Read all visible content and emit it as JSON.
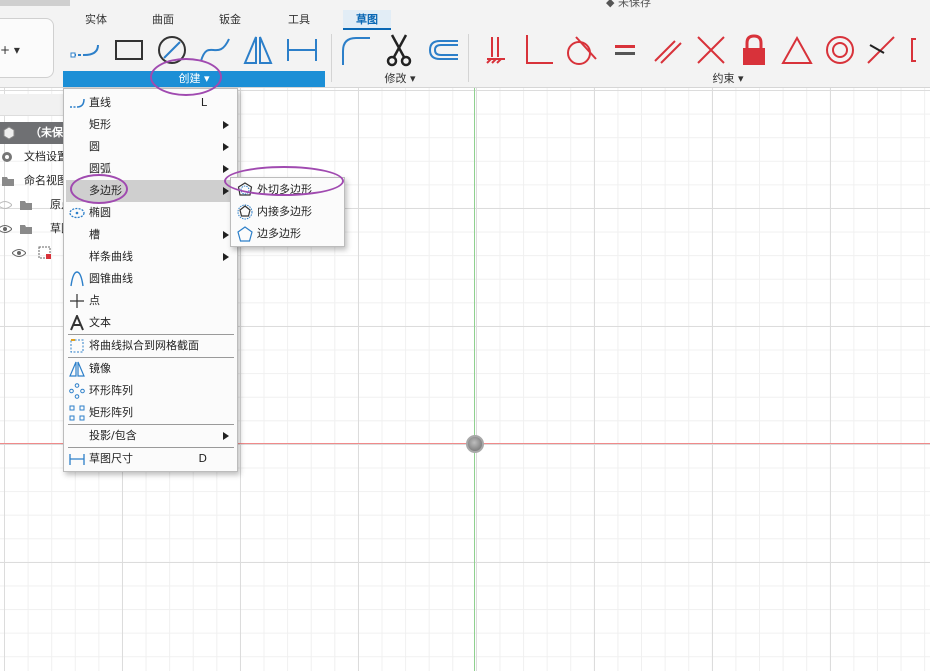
{
  "window": {
    "title": "未保存"
  },
  "workspace": {
    "label": "+ ▾"
  },
  "tabs": [
    {
      "label": "实体"
    },
    {
      "label": "曲面"
    },
    {
      "label": "钣金"
    },
    {
      "label": "工具"
    },
    {
      "label": "草图"
    }
  ],
  "groups": {
    "create": "创建 ▾",
    "modify": "修改 ▾",
    "constraints": "约束 ▾"
  },
  "browser": {
    "root": "（未保存）",
    "items": [
      {
        "label": "文档设置",
        "icon": "gear-icon"
      },
      {
        "label": "命名视图",
        "icon": "folder-icon"
      },
      {
        "label": "原点",
        "icon": "folder-icon"
      },
      {
        "label": "草图",
        "icon": "folder-icon"
      }
    ]
  },
  "create_menu": {
    "items": [
      {
        "label": "直线",
        "shortcut": "L",
        "icon": "line-icon"
      },
      {
        "label": "矩形",
        "icon": "rectangle-icon"
      },
      {
        "label": "圆",
        "icon": "circle-icon"
      },
      {
        "label": "圆弧",
        "icon": "arc-icon"
      },
      {
        "label": "多边形",
        "icon": "polygon-icon"
      },
      {
        "label": "椭圆",
        "icon": "ellipse-icon"
      },
      {
        "label": "槽",
        "icon": "slot-icon"
      },
      {
        "label": "样条曲线",
        "icon": "spline-icon"
      },
      {
        "label": "圆锥曲线",
        "icon": "conic-curve-icon"
      },
      {
        "label": "点",
        "icon": "point-icon"
      },
      {
        "label": "文本",
        "icon": "text-icon"
      },
      {
        "label": "将曲线拟合到网格截面",
        "icon": "fit-curve-icon"
      },
      {
        "label": "镜像",
        "icon": "mirror-icon"
      },
      {
        "label": "环形阵列",
        "icon": "circular-pattern-icon"
      },
      {
        "label": "矩形阵列",
        "icon": "rectangular-pattern-icon"
      },
      {
        "label": "投影/包含",
        "icon": "project-icon"
      },
      {
        "label": "草图尺寸",
        "shortcut": "D",
        "icon": "dimension-icon"
      }
    ]
  },
  "polygon_submenu": {
    "items": [
      {
        "label": "外切多边形",
        "icon": "circumscribed-polygon-icon"
      },
      {
        "label": "内接多边形",
        "icon": "inscribed-polygon-icon"
      },
      {
        "label": "边多边形",
        "icon": "edge-polygon-icon"
      }
    ]
  },
  "colors": {
    "accent": "#1c8fd6",
    "tool_blue": "#2c7fc9",
    "constraint_red": "#d8323a",
    "annotation": "#a04ab0",
    "axis_x": "#f08a8a",
    "axis_y": "#8fd08f"
  }
}
